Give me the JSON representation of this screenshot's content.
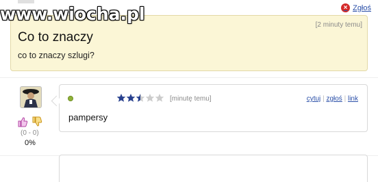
{
  "watermark": "www.wiocha.pl",
  "top": {
    "report_label": "Zgłoś"
  },
  "question": {
    "title": "Co to znaczy",
    "body": "co to znaczy szlugi?",
    "time": "[2 minuty temu]"
  },
  "answer": {
    "rating_filled": 2.5,
    "rating_max": 5,
    "time": "[minutę temu]",
    "actions": {
      "quote": "cytuj",
      "report": "zgłoś",
      "link": "link",
      "separator": "|"
    },
    "body": "pampersy",
    "votes": {
      "count": "(0 - 0)",
      "percent": "0%"
    }
  },
  "colors": {
    "question_bg": "#fbf6d6",
    "link": "#2a4fa8",
    "star_filled": "#27408f",
    "star_empty": "#cccccc",
    "online": "#8fb23a"
  },
  "icons": {
    "report": "report-x-icon",
    "thumb_up": "thumb-up-icon",
    "thumb_down": "thumb-down-icon",
    "online": "online-dot-icon",
    "star": "star-icon"
  }
}
